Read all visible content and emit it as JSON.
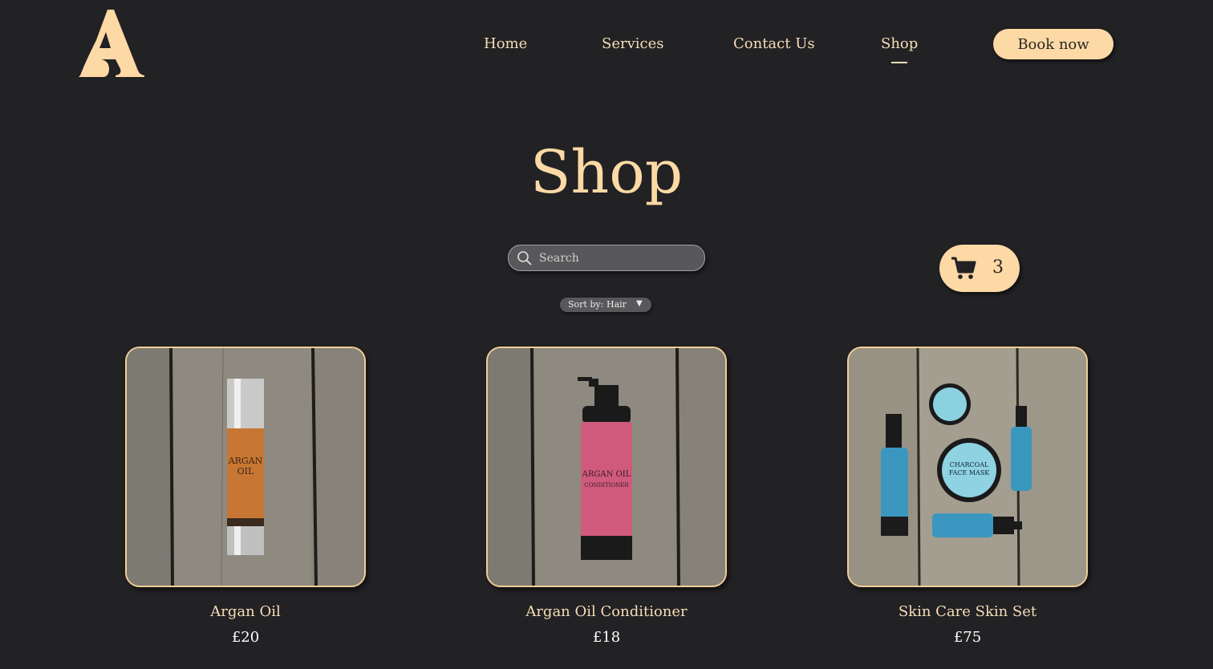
{
  "header": {
    "logo_letter": "A",
    "nav": [
      {
        "label": "Home",
        "active": false
      },
      {
        "label": "Services",
        "active": false
      },
      {
        "label": "Contact Us",
        "active": false
      },
      {
        "label": "Shop",
        "active": true
      }
    ],
    "book_button": "Book now"
  },
  "page": {
    "title": "Shop"
  },
  "search": {
    "placeholder": "Search"
  },
  "sort": {
    "label": "Sort by:",
    "value": "Hair"
  },
  "cart": {
    "count": "3"
  },
  "products": [
    {
      "name": "Argan Oil",
      "price": "£20",
      "label_line1": "ARGAN",
      "label_line2": "OIL"
    },
    {
      "name": "Argan Oil Conditioner",
      "price": "£18",
      "label_line1": "ARGAN OIL",
      "label_line2": "CONDITIONER"
    },
    {
      "name": "Skin Care Skin Set",
      "price": "£75",
      "label_line1": "CHARCOAL",
      "label_line2": "FACE MASK"
    }
  ],
  "colors": {
    "background": "#222124",
    "accent": "#fcd9a5",
    "text_gold": "#f6ddb7"
  }
}
